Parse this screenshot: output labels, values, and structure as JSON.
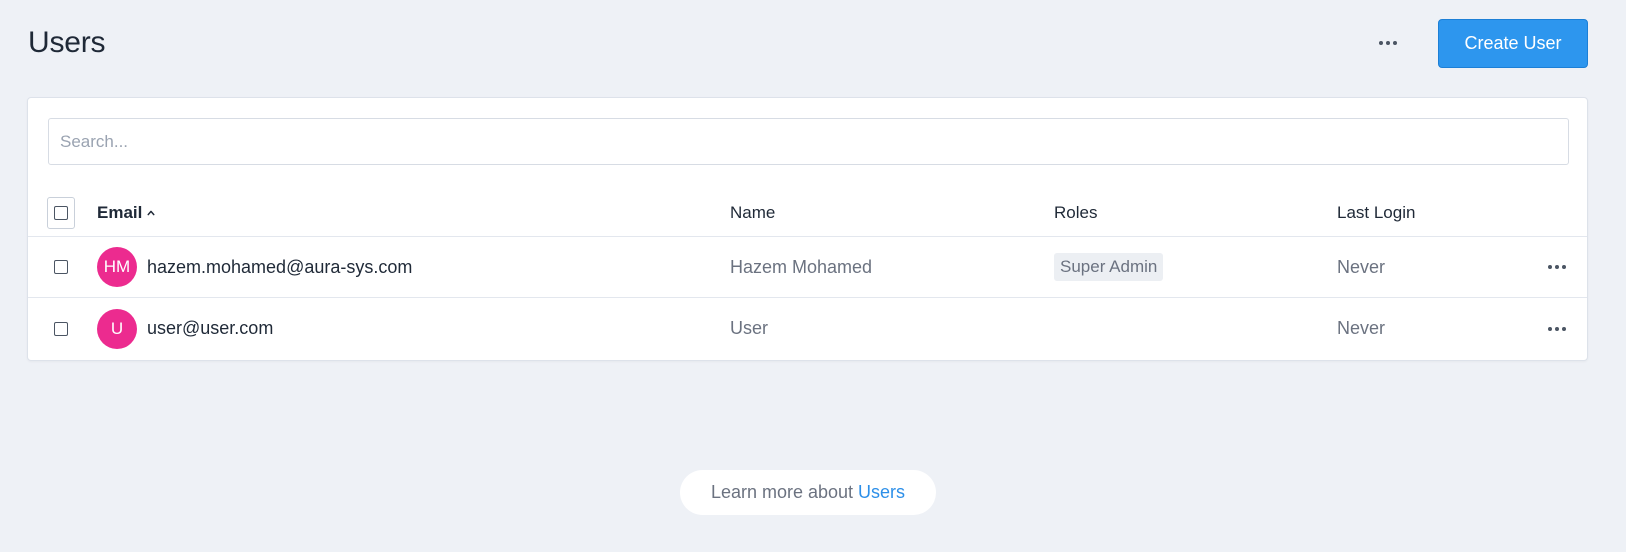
{
  "header": {
    "title": "Users",
    "more_icon": "more-horizontal-icon",
    "create_label": "Create User",
    "accent": "#2d96ee"
  },
  "search": {
    "placeholder": "Search..."
  },
  "table": {
    "columns": [
      {
        "key": "email",
        "label": "Email",
        "sorted": "ascending"
      },
      {
        "key": "name",
        "label": "Name"
      },
      {
        "key": "roles",
        "label": "Roles"
      },
      {
        "key": "last_login",
        "label": "Last Login"
      }
    ],
    "rows": [
      {
        "initials": "HM",
        "email": "hazem.mohamed@aura-sys.com",
        "name": "Hazem Mohamed",
        "role": "Super Admin",
        "last_login": "Never",
        "avatar_color": "#ec2b8f"
      },
      {
        "initials": "U",
        "email": "user@user.com",
        "name": "User",
        "role": "",
        "last_login": "Never",
        "avatar_color": "#ec2b8f"
      }
    ]
  },
  "footer": {
    "learn_prefix": "Learn more about",
    "learn_link": "Users"
  }
}
